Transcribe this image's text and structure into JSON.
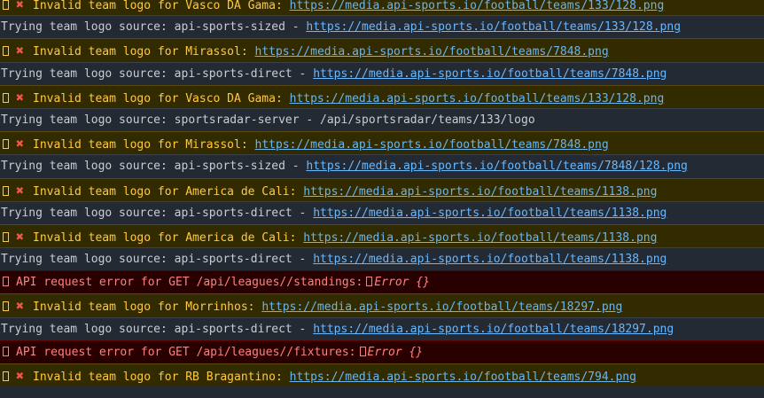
{
  "colors": {
    "warning_bg": "#332b00",
    "warning_text": "#ffc940",
    "log_bg": "#242a33",
    "log_text": "#c9cdd3",
    "error_bg": "#290000",
    "error_text": "#ff8080",
    "link": "#67b8ff",
    "x_icon": "#f4554a"
  },
  "icons": {
    "warning_glyph": "missing-glyph-icon",
    "x_mark": "cross-mark-icon"
  },
  "rows": [
    {
      "type": "warn",
      "msg": "Invalid team logo for Vasco DA Gama:",
      "link": "https://media.api-sports.io/football/teams/133/128.png"
    },
    {
      "type": "log",
      "msg": "Trying team logo source: api-sports-sized - ",
      "link": "https://media.api-sports.io/football/teams/133/128.png"
    },
    {
      "type": "warn",
      "msg": "Invalid team logo for Mirassol:",
      "link": "https://media.api-sports.io/football/teams/7848.png"
    },
    {
      "type": "log",
      "msg": "Trying team logo source: api-sports-direct - ",
      "link": "https://media.api-sports.io/football/teams/7848.png"
    },
    {
      "type": "warn",
      "msg": "Invalid team logo for Vasco DA Gama:",
      "link": "https://media.api-sports.io/football/teams/133/128.png"
    },
    {
      "type": "log",
      "msg": "Trying team logo source: sportsradar-server - /api/sportsradar/teams/133/logo",
      "link": ""
    },
    {
      "type": "warn",
      "msg": "Invalid team logo for Mirassol:",
      "link": "https://media.api-sports.io/football/teams/7848.png"
    },
    {
      "type": "log",
      "msg": "Trying team logo source: api-sports-sized - ",
      "link": "https://media.api-sports.io/football/teams/7848/128.png"
    },
    {
      "type": "warn",
      "msg": "Invalid team logo for America de Cali:",
      "link": "https://media.api-sports.io/football/teams/1138.png"
    },
    {
      "type": "log",
      "msg": "Trying team logo source: api-sports-direct - ",
      "link": "https://media.api-sports.io/football/teams/1138.png"
    },
    {
      "type": "warn",
      "msg": "Invalid team logo for America de Cali:",
      "link": "https://media.api-sports.io/football/teams/1138.png"
    },
    {
      "type": "log",
      "msg": "Trying team logo source: api-sports-direct - ",
      "link": "https://media.api-sports.io/football/teams/1138.png"
    },
    {
      "type": "err",
      "msg": "API request error for GET /api/leagues//standings:",
      "obj": "Error {}"
    },
    {
      "type": "warn",
      "msg": "Invalid team logo for Morrinhos:",
      "link": "https://media.api-sports.io/football/teams/18297.png"
    },
    {
      "type": "log",
      "msg": "Trying team logo source: api-sports-direct - ",
      "link": "https://media.api-sports.io/football/teams/18297.png"
    },
    {
      "type": "err",
      "msg": "API request error for GET /api/leagues//fixtures:",
      "obj": "Error {}"
    },
    {
      "type": "warn",
      "msg": "Invalid team logo for RB Bragantino:",
      "link": "https://media.api-sports.io/football/teams/794.png"
    }
  ]
}
